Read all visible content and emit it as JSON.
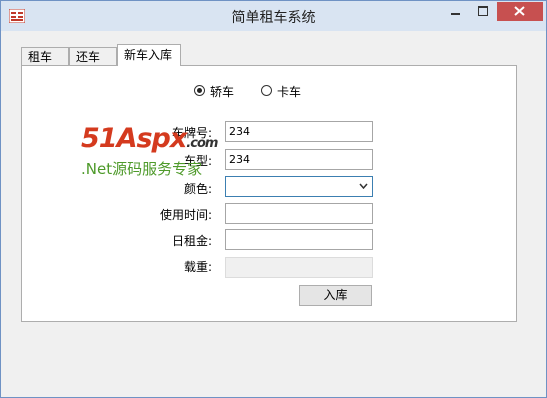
{
  "window": {
    "title": "简单租车系统"
  },
  "tabs": [
    {
      "label": "租车"
    },
    {
      "label": "还车"
    },
    {
      "label": "新车入库"
    }
  ],
  "form": {
    "radio_sedan": {
      "label": "轿车",
      "checked": true
    },
    "radio_truck": {
      "label": "卡车",
      "checked": false
    },
    "plate": {
      "label": "车牌号:",
      "value": "234"
    },
    "model": {
      "label": "车型:",
      "value": "234"
    },
    "color": {
      "label": "颜色:",
      "value": ""
    },
    "usage_time": {
      "label": "使用时间:",
      "value": ""
    },
    "daily_rent": {
      "label": "日租金:",
      "value": ""
    },
    "load": {
      "label": "载重:",
      "value": ""
    },
    "submit_label": "入库"
  },
  "watermark": {
    "brand": "51Aspx",
    "domain": ".com",
    "slogan": ".Net源码服务专家"
  },
  "colors": {
    "accent_red": "#d43a1e",
    "accent_green": "#4e9a2a",
    "close_button": "#c75050"
  }
}
